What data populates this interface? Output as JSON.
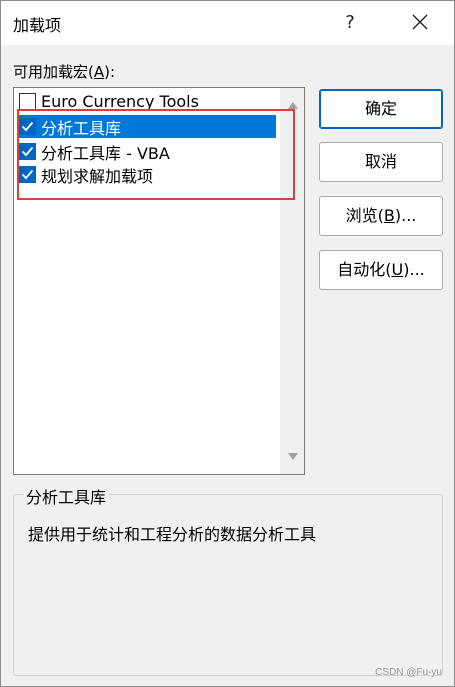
{
  "window": {
    "title": "加载项",
    "help_glyph": "?",
    "close_icon": "close-icon"
  },
  "addins": {
    "label_prefix": "可用加载宏(",
    "label_accel": "A",
    "label_suffix": "):",
    "items": [
      {
        "label": "Euro Currency Tools",
        "checked": false,
        "selected": false
      },
      {
        "label": "分析工具库",
        "checked": true,
        "selected": true
      },
      {
        "label": "分析工具库 - VBA",
        "checked": true,
        "selected": false
      },
      {
        "label": "规划求解加载项",
        "checked": true,
        "selected": false
      }
    ]
  },
  "buttons": {
    "ok": "确定",
    "cancel": "取消",
    "browse_prefix": "浏览(",
    "browse_accel": "B",
    "browse_suffix": ")...",
    "automation_prefix": "自动化(",
    "automation_accel": "U",
    "automation_suffix": ")..."
  },
  "description": {
    "title": "分析工具库",
    "text": "提供用于统计和工程分析的数据分析工具"
  },
  "watermark": "CSDN @Fu-yu",
  "colors": {
    "selection": "#0078d7",
    "checkbox": "#0067c0",
    "highlight_annotation": "#e03c3c"
  }
}
